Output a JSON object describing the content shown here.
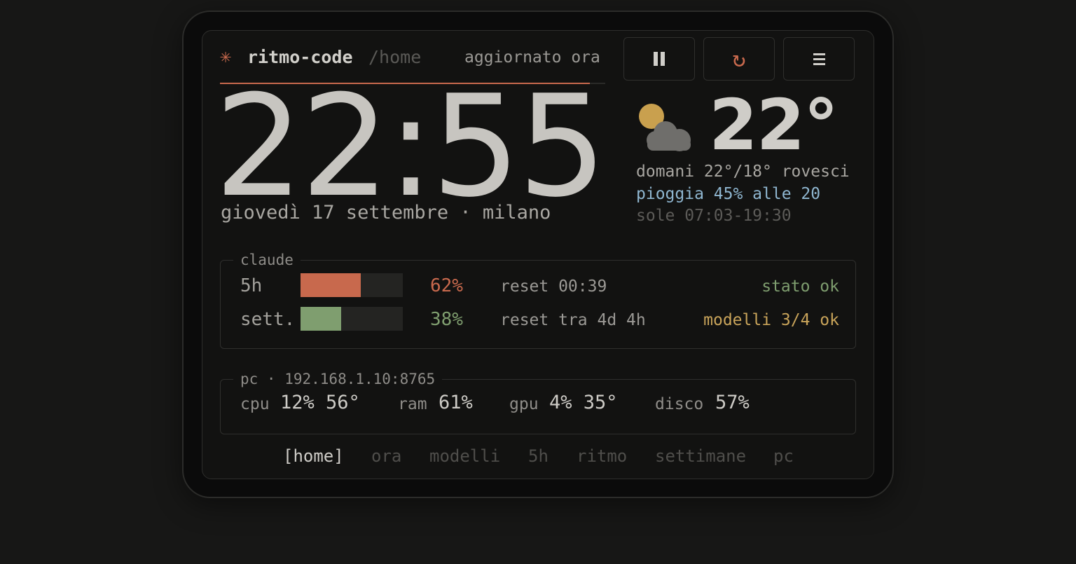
{
  "colors": {
    "accent": "#c8694d",
    "green": "#7f9e6f",
    "amber": "#c9a45a",
    "blue": "#8fb6d0",
    "sun": "#c9a04e",
    "cloud": "#6f6e6b"
  },
  "header": {
    "app_icon": "asterisk-icon",
    "app_name": "ritmo-code",
    "path": "/home",
    "updated": "aggiornato ora",
    "buttons": {
      "pause": {
        "icon": "pause-icon",
        "glyph": "❚❚"
      },
      "refresh": {
        "icon": "refresh-icon",
        "glyph": "↻"
      },
      "menu": {
        "icon": "menu-icon",
        "glyph": "≡"
      }
    }
  },
  "clock": {
    "time": "22:55",
    "date": "giovedì 17 settembre · milano"
  },
  "weather": {
    "icon": "partly-cloudy-icon",
    "temperature": "22°",
    "tomorrow": "domani 22°/18° rovesci",
    "rain": "pioggia 45% alle 20",
    "sun": "sole 07:03-19:30"
  },
  "claude": {
    "title": "claude",
    "rows": [
      {
        "label": "5h",
        "fill": 0.59,
        "percent": "62%",
        "reset": "reset 00:39",
        "status": "stato ok"
      },
      {
        "label": "sett.",
        "fill": 0.4,
        "percent": "38%",
        "reset": "reset tra 4d 4h",
        "status": "modelli 3/4 ok"
      }
    ]
  },
  "pc": {
    "title": "pc · 192.168.1.10:8765",
    "stats": [
      {
        "key": "cpu",
        "value": "12% 56°"
      },
      {
        "key": "ram",
        "value": "61%"
      },
      {
        "key": "gpu",
        "value": "4% 35°"
      },
      {
        "key": "disco",
        "value": "57%"
      }
    ]
  },
  "nav": {
    "items": [
      "[home]",
      "ora",
      "modelli",
      "5h",
      "ritmo",
      "settimane",
      "pc"
    ],
    "active_index": 0
  }
}
